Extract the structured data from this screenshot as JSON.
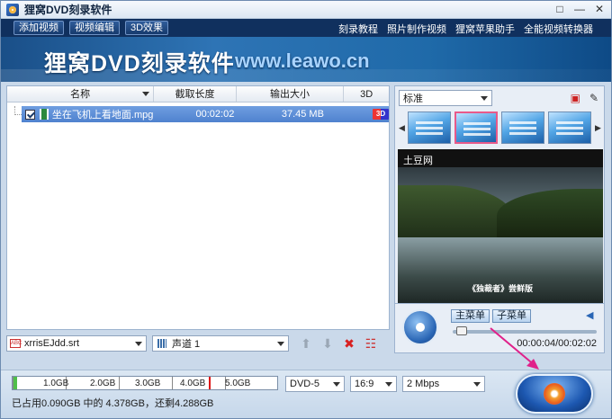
{
  "window": {
    "title": "狸窝DVD刻录软件",
    "controls": [
      "□",
      "—",
      "✕"
    ]
  },
  "menu": {
    "buttons": [
      "添加视频",
      "视频编辑",
      "3D效果"
    ],
    "links": [
      "刻录教程",
      "照片制作视频",
      "狸窝苹果助手",
      "全能视频转换器"
    ]
  },
  "banner": {
    "title": "狸窝DVD刻录软件",
    "url": "www.leawo.cn"
  },
  "file_list": {
    "headers": {
      "name": "名称",
      "trim": "截取长度",
      "output_size": "输出大小",
      "three_d": "3D"
    },
    "rows": [
      {
        "name": "坐在飞机上看地面.mpg",
        "trim": "00:02:02",
        "size": "37.45 MB",
        "three_d_label": "3D"
      }
    ]
  },
  "bottom_tools": {
    "subtitle_value": "xrrisEJdd.srt",
    "audio_value": "声道 1"
  },
  "preview": {
    "template_value": "标准",
    "video_title": "土豆网",
    "video_caption": "《独裁者》尝鲜版"
  },
  "player": {
    "main_menu": "主菜单",
    "sub_menu": "子菜单",
    "time": "00:00:04/00:02:02",
    "progress_fraction": 0.03
  },
  "footer": {
    "capacity_labels": [
      "1.0GB",
      "2.0GB",
      "3.0GB",
      "4.0GB",
      "5.0GB"
    ],
    "used_fraction": 0.018,
    "usage_text": "已占用0.090GB 中的 4.378GB，还剩4.288GB",
    "disc_type": "DVD-5",
    "aspect": "16:9",
    "bitrate": "2 Mbps"
  },
  "colors": {
    "menubar": "#10305e",
    "selected_row": "#4f82cf",
    "capacity_used": "#4fbf4a",
    "arrow": "#e0218a"
  }
}
